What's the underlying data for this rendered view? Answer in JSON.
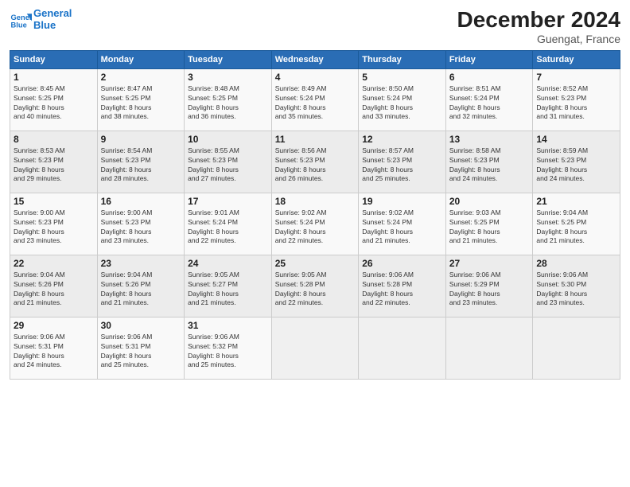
{
  "header": {
    "logo_line1": "General",
    "logo_line2": "Blue",
    "month_title": "December 2024",
    "location": "Guengat, France"
  },
  "days_of_week": [
    "Sunday",
    "Monday",
    "Tuesday",
    "Wednesday",
    "Thursday",
    "Friday",
    "Saturday"
  ],
  "weeks": [
    [
      {
        "day": 1,
        "info": "Sunrise: 8:45 AM\nSunset: 5:25 PM\nDaylight: 8 hours\nand 40 minutes."
      },
      {
        "day": 2,
        "info": "Sunrise: 8:47 AM\nSunset: 5:25 PM\nDaylight: 8 hours\nand 38 minutes."
      },
      {
        "day": 3,
        "info": "Sunrise: 8:48 AM\nSunset: 5:25 PM\nDaylight: 8 hours\nand 36 minutes."
      },
      {
        "day": 4,
        "info": "Sunrise: 8:49 AM\nSunset: 5:24 PM\nDaylight: 8 hours\nand 35 minutes."
      },
      {
        "day": 5,
        "info": "Sunrise: 8:50 AM\nSunset: 5:24 PM\nDaylight: 8 hours\nand 33 minutes."
      },
      {
        "day": 6,
        "info": "Sunrise: 8:51 AM\nSunset: 5:24 PM\nDaylight: 8 hours\nand 32 minutes."
      },
      {
        "day": 7,
        "info": "Sunrise: 8:52 AM\nSunset: 5:23 PM\nDaylight: 8 hours\nand 31 minutes."
      }
    ],
    [
      {
        "day": 8,
        "info": "Sunrise: 8:53 AM\nSunset: 5:23 PM\nDaylight: 8 hours\nand 29 minutes."
      },
      {
        "day": 9,
        "info": "Sunrise: 8:54 AM\nSunset: 5:23 PM\nDaylight: 8 hours\nand 28 minutes."
      },
      {
        "day": 10,
        "info": "Sunrise: 8:55 AM\nSunset: 5:23 PM\nDaylight: 8 hours\nand 27 minutes."
      },
      {
        "day": 11,
        "info": "Sunrise: 8:56 AM\nSunset: 5:23 PM\nDaylight: 8 hours\nand 26 minutes."
      },
      {
        "day": 12,
        "info": "Sunrise: 8:57 AM\nSunset: 5:23 PM\nDaylight: 8 hours\nand 25 minutes."
      },
      {
        "day": 13,
        "info": "Sunrise: 8:58 AM\nSunset: 5:23 PM\nDaylight: 8 hours\nand 24 minutes."
      },
      {
        "day": 14,
        "info": "Sunrise: 8:59 AM\nSunset: 5:23 PM\nDaylight: 8 hours\nand 24 minutes."
      }
    ],
    [
      {
        "day": 15,
        "info": "Sunrise: 9:00 AM\nSunset: 5:23 PM\nDaylight: 8 hours\nand 23 minutes."
      },
      {
        "day": 16,
        "info": "Sunrise: 9:00 AM\nSunset: 5:23 PM\nDaylight: 8 hours\nand 23 minutes."
      },
      {
        "day": 17,
        "info": "Sunrise: 9:01 AM\nSunset: 5:24 PM\nDaylight: 8 hours\nand 22 minutes."
      },
      {
        "day": 18,
        "info": "Sunrise: 9:02 AM\nSunset: 5:24 PM\nDaylight: 8 hours\nand 22 minutes."
      },
      {
        "day": 19,
        "info": "Sunrise: 9:02 AM\nSunset: 5:24 PM\nDaylight: 8 hours\nand 21 minutes."
      },
      {
        "day": 20,
        "info": "Sunrise: 9:03 AM\nSunset: 5:25 PM\nDaylight: 8 hours\nand 21 minutes."
      },
      {
        "day": 21,
        "info": "Sunrise: 9:04 AM\nSunset: 5:25 PM\nDaylight: 8 hours\nand 21 minutes."
      }
    ],
    [
      {
        "day": 22,
        "info": "Sunrise: 9:04 AM\nSunset: 5:26 PM\nDaylight: 8 hours\nand 21 minutes."
      },
      {
        "day": 23,
        "info": "Sunrise: 9:04 AM\nSunset: 5:26 PM\nDaylight: 8 hours\nand 21 minutes."
      },
      {
        "day": 24,
        "info": "Sunrise: 9:05 AM\nSunset: 5:27 PM\nDaylight: 8 hours\nand 21 minutes."
      },
      {
        "day": 25,
        "info": "Sunrise: 9:05 AM\nSunset: 5:28 PM\nDaylight: 8 hours\nand 22 minutes."
      },
      {
        "day": 26,
        "info": "Sunrise: 9:06 AM\nSunset: 5:28 PM\nDaylight: 8 hours\nand 22 minutes."
      },
      {
        "day": 27,
        "info": "Sunrise: 9:06 AM\nSunset: 5:29 PM\nDaylight: 8 hours\nand 23 minutes."
      },
      {
        "day": 28,
        "info": "Sunrise: 9:06 AM\nSunset: 5:30 PM\nDaylight: 8 hours\nand 23 minutes."
      }
    ],
    [
      {
        "day": 29,
        "info": "Sunrise: 9:06 AM\nSunset: 5:31 PM\nDaylight: 8 hours\nand 24 minutes."
      },
      {
        "day": 30,
        "info": "Sunrise: 9:06 AM\nSunset: 5:31 PM\nDaylight: 8 hours\nand 25 minutes."
      },
      {
        "day": 31,
        "info": "Sunrise: 9:06 AM\nSunset: 5:32 PM\nDaylight: 8 hours\nand 25 minutes."
      },
      null,
      null,
      null,
      null
    ]
  ]
}
